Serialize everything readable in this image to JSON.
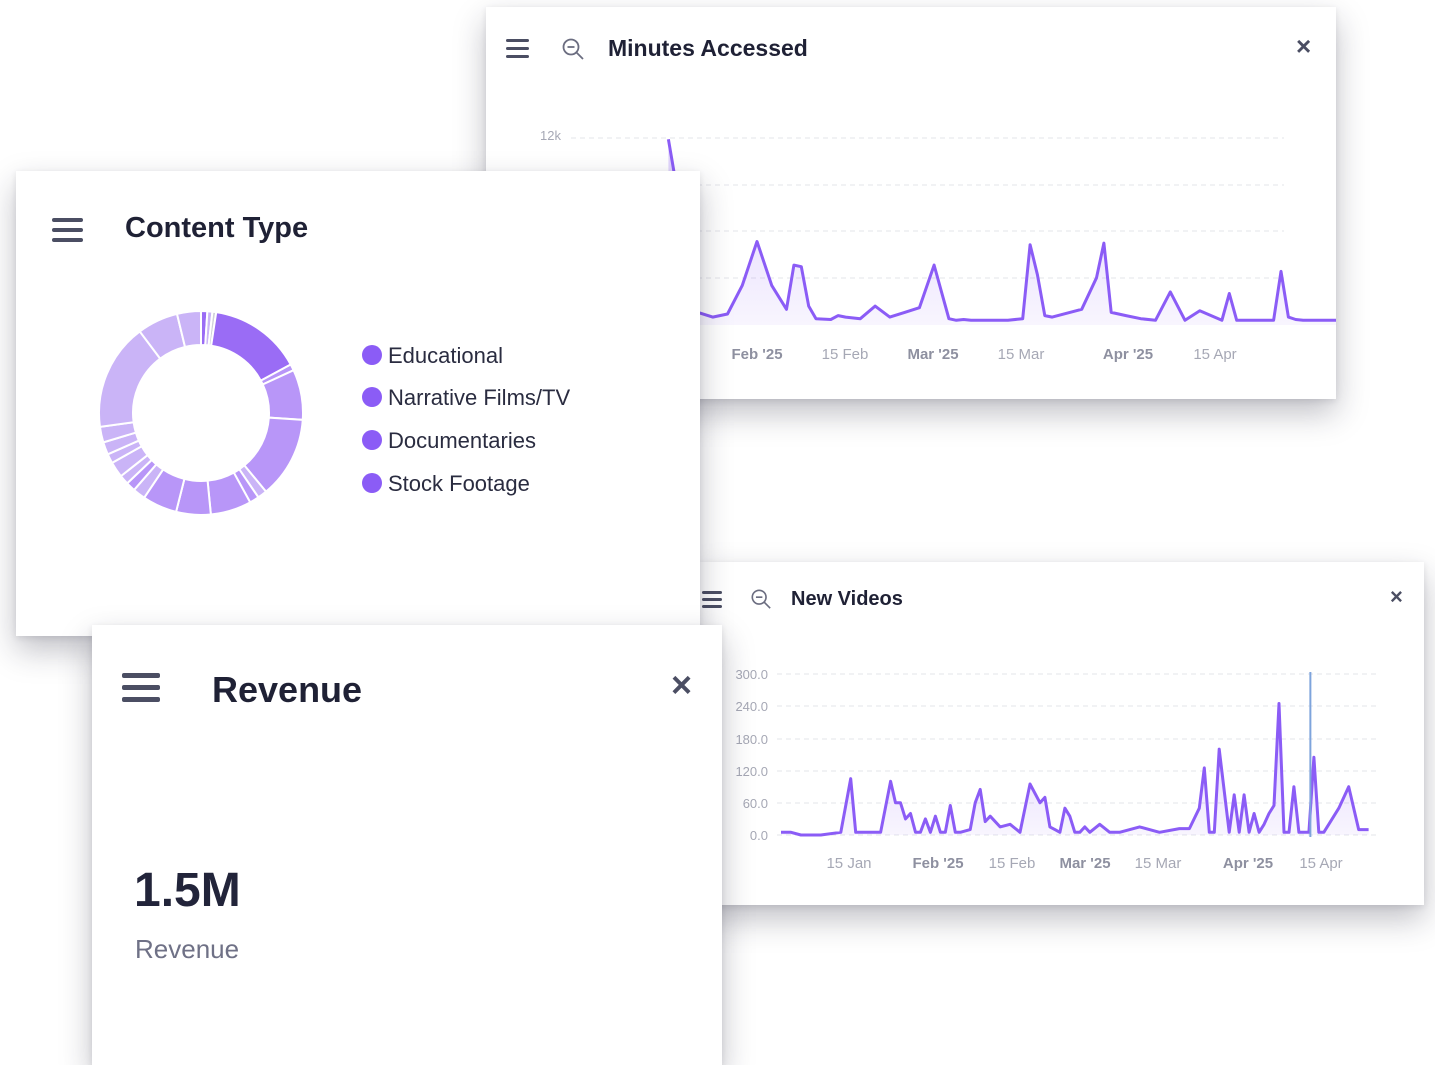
{
  "colors": {
    "accent": "#8b5cf6",
    "donut_dark": "#9a6cf5",
    "donut_mid": "#b896f8",
    "donut_light": "#cab4f7",
    "text_dark": "#1f2135",
    "text_muted": "#6f7186"
  },
  "minutes_card": {
    "title": "Minutes Accessed",
    "close_icon": "×",
    "menu_icon": "hamburger-icon",
    "zoom_icon": "zoom-out-icon"
  },
  "content_card": {
    "title": "Content Type",
    "menu_icon": "hamburger-icon",
    "legend": [
      "Educational",
      "Narrative Films/TV",
      "Documentaries",
      "Stock Footage"
    ]
  },
  "videos_card": {
    "title": "New Videos",
    "close_icon": "×",
    "menu_icon": "hamburger-icon",
    "zoom_icon": "zoom-out-icon"
  },
  "revenue_card": {
    "title": "Revenue",
    "close_icon": "×",
    "menu_icon": "hamburger-icon",
    "value": "1.5M",
    "label": "Revenue"
  },
  "chart_data": [
    {
      "id": "minutes",
      "type": "area",
      "title": "Minutes Accessed",
      "y_tick_labels": [
        "12k"
      ],
      "x_tick_labels": [
        {
          "label": "Feb '25",
          "bold": true
        },
        {
          "label": "15 Feb",
          "bold": false
        },
        {
          "label": "Mar '25",
          "bold": true
        },
        {
          "label": "15 Mar",
          "bold": false
        },
        {
          "label": "Apr '25",
          "bold": true
        },
        {
          "label": "15 Apr",
          "bold": false
        }
      ],
      "ylim": [
        0,
        12000
      ],
      "grid": true,
      "series": [
        {
          "color": "#8b5cf6",
          "x": [
            -12,
            -8,
            -6,
            -4,
            -2,
            0,
            2,
            4,
            5,
            6,
            7,
            8,
            10,
            11,
            12,
            14,
            16,
            18,
            20,
            22,
            24,
            26,
            27,
            28,
            29,
            30,
            32,
            34,
            36,
            37,
            38,
            39,
            40,
            44,
            46,
            47,
            48,
            49,
            50,
            52,
            54,
            56,
            58,
            60,
            62,
            63,
            64,
            65,
            66,
            68,
            70,
            71,
            72,
            73,
            74,
            76,
            78,
            80,
            82,
            84,
            86,
            87,
            88,
            89,
            90,
            92,
            94,
            96,
            98,
            100,
            101,
            102,
            103,
            104,
            106,
            108
          ],
          "y": [
            11800,
            800,
            500,
            700,
            2500,
            5300,
            2500,
            1000,
            3800,
            3700,
            1200,
            400,
            350,
            600,
            500,
            400,
            1200,
            500,
            800,
            1100,
            3800,
            400,
            300,
            350,
            300,
            300,
            300,
            300,
            400,
            5100,
            3200,
            600,
            500,
            1000,
            3000,
            5200,
            800,
            700,
            600,
            400,
            300,
            2100,
            300,
            900,
            500,
            300,
            2000,
            300,
            300,
            300,
            300,
            3400,
            500,
            350,
            300,
            300,
            300,
            300,
            300,
            300,
            300,
            3700,
            400,
            300,
            300,
            300,
            300,
            300,
            400,
            500,
            2700,
            2600,
            400,
            300,
            200,
            100
          ]
        }
      ]
    },
    {
      "id": "content_type",
      "type": "pie",
      "title": "Content Type",
      "categories": [
        "Educational",
        "Narrative Films/TV",
        "Documentaries",
        "Stock Footage"
      ],
      "legend_position": "right",
      "slices": [
        {
          "value": 1.0,
          "shade": "dark"
        },
        {
          "value": 0.8,
          "shade": "light"
        },
        {
          "value": 0.6,
          "shade": "grey"
        },
        {
          "value": 14.8,
          "shade": "dark"
        },
        {
          "value": 1.0,
          "shade": "mid"
        },
        {
          "value": 8.0,
          "shade": "mid"
        },
        {
          "value": 13.0,
          "shade": "mid"
        },
        {
          "value": 1.5,
          "shade": "light"
        },
        {
          "value": 1.5,
          "shade": "mid"
        },
        {
          "value": 6.5,
          "shade": "mid"
        },
        {
          "value": 5.5,
          "shade": "mid"
        },
        {
          "value": 5.5,
          "shade": "mid"
        },
        {
          "value": 2.0,
          "shade": "light"
        },
        {
          "value": 1.5,
          "shade": "mid"
        },
        {
          "value": 1.5,
          "shade": "light"
        },
        {
          "value": 2.5,
          "shade": "light"
        },
        {
          "value": 1.5,
          "shade": "light"
        },
        {
          "value": 2.0,
          "shade": "light"
        },
        {
          "value": 2.5,
          "shade": "light"
        },
        {
          "value": 17.0,
          "shade": "light"
        },
        {
          "value": 6.5,
          "shade": "light"
        },
        {
          "value": 3.8,
          "shade": "light"
        }
      ]
    },
    {
      "id": "new_videos",
      "type": "area",
      "title": "New Videos",
      "y_tick_labels": [
        "300.0",
        "240.0",
        "180.0",
        "120.0",
        "60.0",
        "0.0"
      ],
      "x_tick_labels": [
        {
          "label": "15 Jan",
          "bold": false
        },
        {
          "label": "Feb '25",
          "bold": true
        },
        {
          "label": "15 Feb",
          "bold": false
        },
        {
          "label": "Mar '25",
          "bold": true
        },
        {
          "label": "15 Mar",
          "bold": false
        },
        {
          "label": "Apr '25",
          "bold": true
        },
        {
          "label": "15 Apr",
          "bold": false
        }
      ],
      "ylim": [
        0,
        300
      ],
      "grid": true,
      "crosshair_day": 106.3,
      "series": [
        {
          "color": "#8b5cf6",
          "x": [
            0,
            2,
            4,
            8,
            12,
            14,
            15,
            16,
            17,
            18,
            20,
            22,
            23,
            24,
            25,
            26,
            27,
            28,
            29,
            30,
            31,
            32,
            33,
            34,
            35,
            36,
            38,
            39,
            40,
            41,
            42,
            44,
            46,
            48,
            50,
            52,
            53,
            54,
            55,
            56,
            57,
            58,
            59,
            60,
            61,
            62,
            64,
            66,
            68,
            72,
            76,
            80,
            82,
            84,
            85,
            86,
            87,
            88,
            90,
            91,
            92,
            93,
            94,
            95,
            96,
            97,
            98,
            99,
            100,
            101,
            102,
            103,
            104,
            106,
            107,
            108,
            109,
            110,
            112,
            114,
            116,
            117,
            118
          ],
          "y": [
            5,
            5,
            0,
            0,
            5,
            105,
            5,
            5,
            5,
            5,
            5,
            100,
            60,
            60,
            30,
            40,
            5,
            5,
            30,
            5,
            35,
            5,
            5,
            55,
            5,
            5,
            10,
            60,
            85,
            25,
            35,
            15,
            20,
            5,
            95,
            60,
            70,
            15,
            10,
            5,
            50,
            35,
            5,
            5,
            15,
            5,
            20,
            5,
            5,
            15,
            5,
            12,
            12,
            50,
            125,
            5,
            5,
            160,
            5,
            75,
            5,
            75,
            5,
            40,
            5,
            20,
            40,
            55,
            245,
            5,
            5,
            90,
            5,
            5,
            145,
            5,
            5,
            20,
            50,
            90,
            10,
            10,
            10
          ]
        }
      ]
    }
  ]
}
